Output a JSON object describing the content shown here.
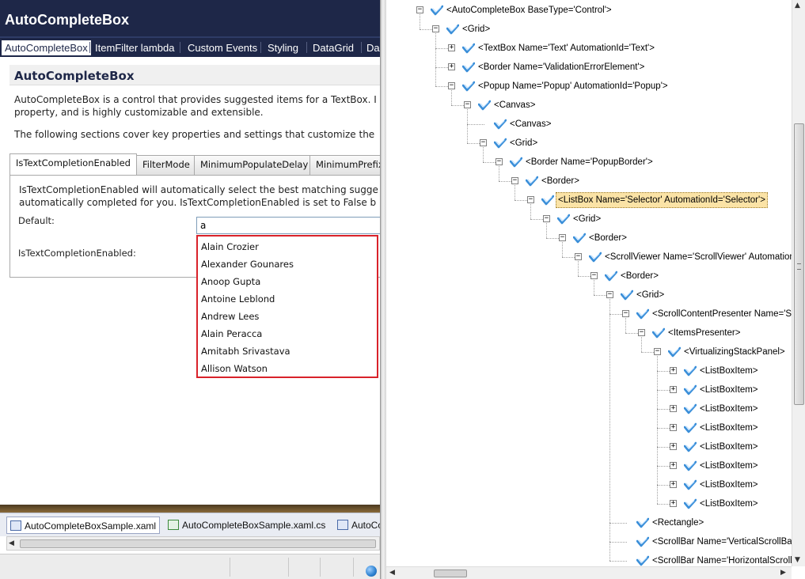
{
  "app": {
    "title": "AutoCompleteBox"
  },
  "main_tabs": [
    "AutoCompleteBox",
    "ItemFilter lambda",
    "Custom Events",
    "Styling",
    "DataGrid",
    "Da"
  ],
  "section": {
    "title": "AutoCompleteBox",
    "para1_line1": "AutoCompleteBox is a control that provides suggested items for a TextBox. I",
    "para1_line2": "property, and is highly customizable and extensible.",
    "para2": "The following sections cover key properties and settings that customize the"
  },
  "demo": {
    "tabs": [
      "IsTextCompletionEnabled",
      "FilterMode",
      "MinimumPopulateDelay",
      "MinimumPrefix"
    ],
    "text_line1": "IsTextCompletionEnabled will automatically select the best matching sugge",
    "text_line2": "automatically completed for you. IsTextCompletionEnabled is set to False b",
    "default_label": "Default:",
    "enabled_label": "IsTextCompletionEnabled:",
    "input_value": "a",
    "suggestions": [
      "Alain Crozier",
      "Alexander Gounares",
      "Anoop Gupta",
      "Antoine Leblond",
      "Andrew Lees",
      "Alain Peracca",
      "Amitabh Srivastava",
      "Allison Watson"
    ]
  },
  "doc_tabs": [
    "AutoCompleteBoxSample.xaml",
    "AutoCompleteBoxSample.xaml.cs",
    "AutoCo"
  ],
  "tree": {
    "nodes": [
      {
        "label": "<AutoCompleteBox BaseType='Control'>",
        "level": 0,
        "exp": "minus"
      },
      {
        "label": "<Grid>",
        "level": 1,
        "exp": "minus"
      },
      {
        "label": "<TextBox Name='Text' AutomationId='Text'>",
        "level": 2,
        "exp": "plus"
      },
      {
        "label": "<Border Name='ValidationErrorElement'>",
        "level": 2,
        "exp": "plus"
      },
      {
        "label": "<Popup Name='Popup' AutomationId='Popup'>",
        "level": 2,
        "exp": "minus"
      },
      {
        "label": "<Canvas>",
        "level": 3,
        "exp": "minus"
      },
      {
        "label": "<Canvas>",
        "level": 4,
        "exp": "none"
      },
      {
        "label": "<Grid>",
        "level": 4,
        "exp": "minus"
      },
      {
        "label": "<Border Name='PopupBorder'>",
        "level": 5,
        "exp": "minus"
      },
      {
        "label": "<Border>",
        "level": 6,
        "exp": "minus"
      },
      {
        "label": "<ListBox Name='Selector' AutomationId='Selector'>",
        "level": 7,
        "exp": "minus",
        "selected": true
      },
      {
        "label": "<Grid>",
        "level": 8,
        "exp": "minus"
      },
      {
        "label": "<Border>",
        "level": 9,
        "exp": "minus"
      },
      {
        "label": "<ScrollViewer Name='ScrollViewer' AutomationId='ScrollViewer'>",
        "level": 10,
        "exp": "minus"
      },
      {
        "label": "<Border>",
        "level": 11,
        "exp": "minus"
      },
      {
        "label": "<Grid>",
        "level": 12,
        "exp": "minus"
      },
      {
        "label": "<ScrollContentPresenter Name='ScrollContentPresenter'>",
        "level": 13,
        "exp": "minus"
      },
      {
        "label": "<ItemsPresenter>",
        "level": 14,
        "exp": "minus"
      },
      {
        "label": "<VirtualizingStackPanel>",
        "level": 15,
        "exp": "minus"
      },
      {
        "label": "<ListBoxItem>",
        "level": 16,
        "exp": "plus"
      },
      {
        "label": "<ListBoxItem>",
        "level": 16,
        "exp": "plus"
      },
      {
        "label": "<ListBoxItem>",
        "level": 16,
        "exp": "plus"
      },
      {
        "label": "<ListBoxItem>",
        "level": 16,
        "exp": "plus"
      },
      {
        "label": "<ListBoxItem>",
        "level": 16,
        "exp": "plus"
      },
      {
        "label": "<ListBoxItem>",
        "level": 16,
        "exp": "plus"
      },
      {
        "label": "<ListBoxItem>",
        "level": 16,
        "exp": "plus"
      },
      {
        "label": "<ListBoxItem>",
        "level": 16,
        "exp": "plus"
      },
      {
        "label": "<Rectangle>",
        "level": 13,
        "exp": "none"
      },
      {
        "label": "<ScrollBar Name='VerticalScrollBar'>",
        "level": 13,
        "exp": "none"
      },
      {
        "label": "<ScrollBar Name='HorizontalScrollBar'>",
        "level": 13,
        "exp": "none"
      }
    ]
  },
  "colors": {
    "title_bar": "#1e2748",
    "dropdown_border": "#d9222a",
    "selected_node": "#fbe3a6",
    "node_icon": "#3b8fd9"
  },
  "icons": [
    "element-icon",
    "expand-plus-icon",
    "collapse-minus-icon",
    "xaml-file-icon",
    "cs-file-icon",
    "globe-icon"
  ]
}
